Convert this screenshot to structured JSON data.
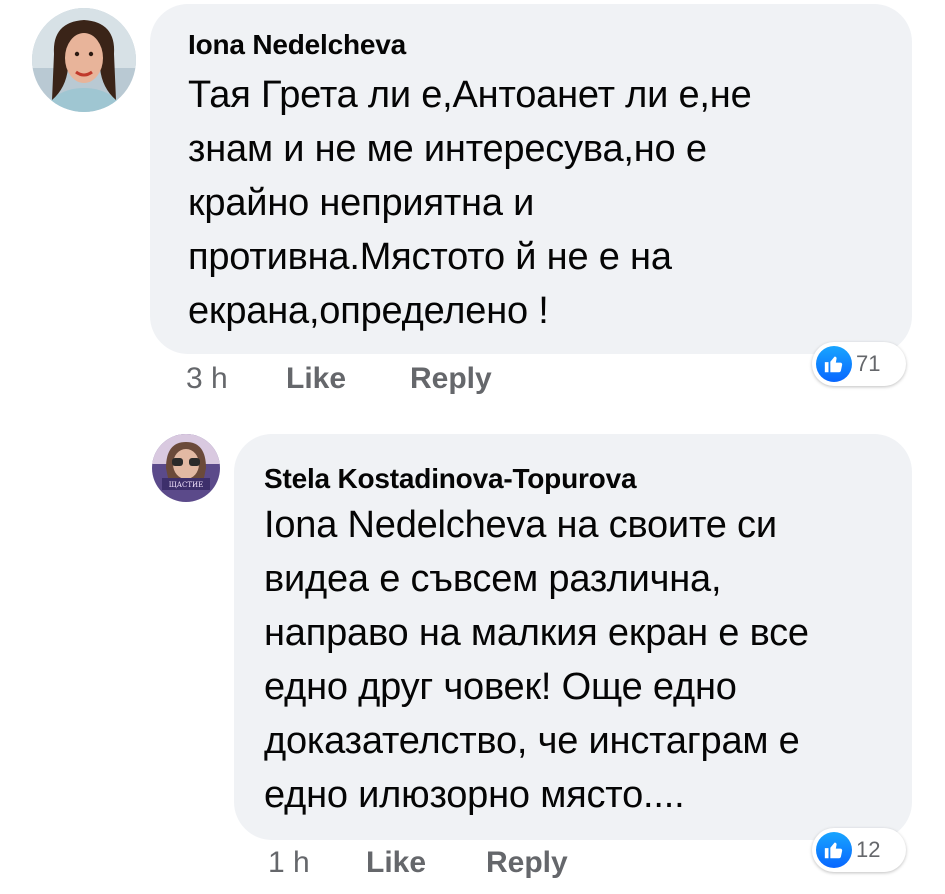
{
  "comments": [
    {
      "author": "Iona Nedelcheva",
      "text": "Тая Грета ли е,Антоанет ли е,не знам и не ме интересува,но е крайно неприятна и противна.Мястото й не е на екрана,определено !",
      "lines": [
        "Тая Грета ли е,Антоанет ли е,не",
        "знам и не ме интересува,но е",
        "крайно неприятна и",
        "противна.Мястото й не е на",
        "екрана,определено !"
      ],
      "time": "3 h",
      "like_label": "Like",
      "reply_label": "Reply",
      "reaction_count": "71",
      "reaction_icon": "thumbs-up-icon"
    },
    {
      "author": "Stela Kostadinova-Topurova",
      "lines": [
        "Iona Nedelcheva  на своите си",
        "видеа е съвсем различна,",
        "направо на малкия екран е все",
        "едно друг човек! Още едно",
        "доказателство, че инстаграм е",
        "едно илюзорно място...."
      ],
      "time": "1 h",
      "like_label": "Like",
      "reply_label": "Reply",
      "reaction_count": "12",
      "reaction_icon": "thumbs-up-icon"
    }
  ],
  "colors": {
    "bubble": "#f0f2f5",
    "text": "#050505",
    "secondary": "#65676b",
    "like_blue": "#0866ff"
  }
}
